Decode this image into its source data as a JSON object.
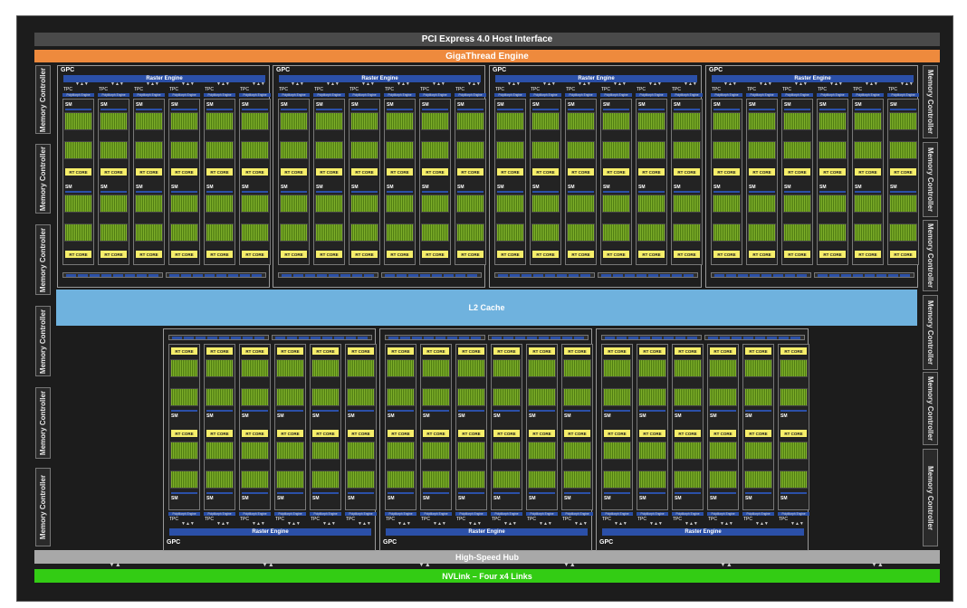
{
  "pcie_label": "PCI Express 4.0 Host Interface",
  "giga_label": "GigaThread Engine",
  "l2_label": "L2 Cache",
  "hub_label": "High-Speed Hub",
  "nvlink_label": "NVLink – Four x4 Links",
  "memory_controller_label": "Memory Controller",
  "gpc_label": "GPC",
  "raster_label": "Raster Engine",
  "tpc_label": "TPC",
  "polymorph_label": "PolyMorph Engine",
  "sm_label": "SM",
  "rt_label": "RT CORE",
  "colors": {
    "chip_background": "#1c1c1c",
    "pcie": "#4a4a4a",
    "gigathread": "#ee8a3d",
    "l2_cache": "#6fb2de",
    "high_speed_hub": "#a8a8a8",
    "nvlink": "#33cc14",
    "raster_engine": "#2b50a8",
    "rt_core": "#f6ee6a",
    "cuda_cores": "#7fb02a"
  }
}
